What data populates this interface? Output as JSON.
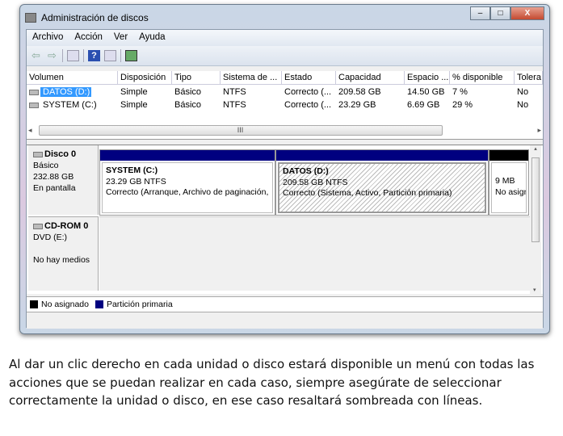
{
  "window": {
    "title": "Administración de discos",
    "controls": {
      "minimize": "–",
      "maximize": "□",
      "close": "X"
    }
  },
  "menu": [
    "Archivo",
    "Acción",
    "Ver",
    "Ayuda"
  ],
  "toolbar": {
    "back": "⇦",
    "forward": "⇨",
    "help": "?"
  },
  "table": {
    "headers": [
      "Volumen",
      "Disposición",
      "Tipo",
      "Sistema de ...",
      "Estado",
      "Capacidad",
      "Espacio ...",
      "% disponible",
      "Tolera"
    ],
    "rows": [
      [
        "DATOS (D:)",
        "Simple",
        "Básico",
        "NTFS",
        "Correcto (...",
        "209.58 GB",
        "14.50 GB",
        "7 %",
        "No"
      ],
      [
        "SYSTEM (C:)",
        "Simple",
        "Básico",
        "NTFS",
        "Correcto (...",
        "23.29 GB",
        "6.69 GB",
        "29 %",
        "No"
      ]
    ]
  },
  "scroll": {
    "grip": "III",
    "left": "◂",
    "right": "▸",
    "up": "▴",
    "down": "▾"
  },
  "disk0": {
    "name": "Disco 0",
    "type": "Básico",
    "size": "232.88 GB",
    "status": "En pantalla",
    "partitions": [
      {
        "name": "SYSTEM  (C:)",
        "size": "23.29 GB NTFS",
        "state": "Correcto (Arranque, Archivo de paginación,"
      },
      {
        "name": "DATOS  (D:)",
        "size": "209.58 GB NTFS",
        "state": "Correcto (Sistema, Activo, Partición primaria)"
      },
      {
        "size": "9 MB",
        "state": "No asignado"
      }
    ]
  },
  "cdrom": {
    "name": "CD-ROM 0",
    "drive": "DVD (E:)",
    "status": "No hay medios"
  },
  "legend": [
    {
      "label": "No asignado",
      "color": "#000000"
    },
    {
      "label": "Partición primaria",
      "color": "#000080"
    }
  ],
  "caption": "Al dar un clic derecho en cada unidad o disco estará disponible un menú con todas las acciones que se puedan realizar en cada caso, siempre asegúrate de seleccionar correctamente la unidad o disco, en ese caso resaltará sombreada con líneas."
}
